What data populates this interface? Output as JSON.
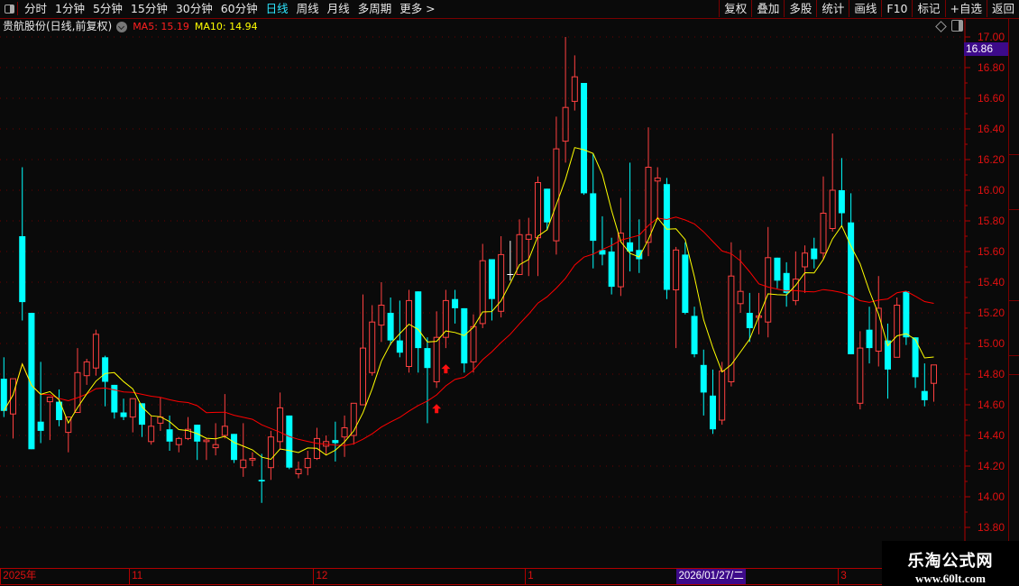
{
  "topbar": {
    "periods": [
      {
        "label": "分时",
        "active": false
      },
      {
        "label": "1分钟",
        "active": false
      },
      {
        "label": "5分钟",
        "active": false
      },
      {
        "label": "15分钟",
        "active": false
      },
      {
        "label": "30分钟",
        "active": false
      },
      {
        "label": "60分钟",
        "active": false
      },
      {
        "label": "日线",
        "active": true
      },
      {
        "label": "周线",
        "active": false
      },
      {
        "label": "月线",
        "active": false
      },
      {
        "label": "多周期",
        "active": false
      },
      {
        "label": "更多 >",
        "active": false
      }
    ],
    "tools": [
      "复权",
      "叠加",
      "多股",
      "统计",
      "画线",
      "F10",
      "标记",
      "+自选",
      "返回"
    ]
  },
  "info": {
    "stock_name": "贵航股份(日线,前复权)",
    "ma5": "MA5: 15.19",
    "ma10": "MA10: 14.94"
  },
  "price_axis": {
    "labels": [
      "17.00",
      "16.80",
      "16.60",
      "16.40",
      "16.20",
      "16.00",
      "15.80",
      "15.60",
      "15.40",
      "15.20",
      "15.00",
      "14.80",
      "14.60",
      "14.40",
      "14.20",
      "14.00",
      "13.80"
    ],
    "current_price": "16.86"
  },
  "date_axis": {
    "labels": [
      {
        "text": "2025年",
        "candle": 0
      },
      {
        "text": "11",
        "candle": 14
      },
      {
        "text": "12",
        "candle": 34
      },
      {
        "text": "1",
        "candle": 57
      },
      {
        "text": "3",
        "candle": 91
      }
    ],
    "cursor_date": "2026/01/27/二",
    "cursor_candle": 77
  },
  "colors": {
    "up": "#ff4040",
    "down": "#00ffff",
    "doji": "#ffffff",
    "ma_fast": "#ffff00",
    "ma_slow": "#ff0000",
    "grid": "#6a0000",
    "signal": "#ff1010"
  },
  "chart_data": {
    "type": "candlestick",
    "ylim": [
      13.8,
      17.0
    ],
    "grid": true,
    "candles_ohlc": [
      [
        14.77,
        14.91,
        14.52,
        14.56
      ],
      [
        14.54,
        14.77,
        14.38,
        14.77
      ],
      [
        15.7,
        16.15,
        15.15,
        15.27
      ],
      [
        15.2,
        15.2,
        14.31,
        14.31
      ],
      [
        14.49,
        14.88,
        14.35,
        14.43
      ],
      [
        14.62,
        14.65,
        14.37,
        14.65
      ],
      [
        14.62,
        14.7,
        14.46,
        14.5
      ],
      [
        14.42,
        14.52,
        14.29,
        14.52
      ],
      [
        14.55,
        14.97,
        14.55,
        14.81
      ],
      [
        14.79,
        14.9,
        14.73,
        14.88
      ],
      [
        14.84,
        15.09,
        14.79,
        15.06
      ],
      [
        14.91,
        14.92,
        14.59,
        14.75
      ],
      [
        14.73,
        14.73,
        14.51,
        14.55
      ],
      [
        14.55,
        14.64,
        14.5,
        14.52
      ],
      [
        14.52,
        14.64,
        14.42,
        14.64
      ],
      [
        14.61,
        14.61,
        14.39,
        14.47
      ],
      [
        14.36,
        14.53,
        14.34,
        14.46
      ],
      [
        14.48,
        14.65,
        14.43,
        14.52
      ],
      [
        14.44,
        14.53,
        14.3,
        14.36
      ],
      [
        14.34,
        14.39,
        14.29,
        14.38
      ],
      [
        14.38,
        14.52,
        14.37,
        14.44
      ],
      [
        14.47,
        14.47,
        14.24,
        14.36
      ],
      [
        14.36,
        14.38,
        14.24,
        14.37
      ],
      [
        14.32,
        14.48,
        14.27,
        14.34
      ],
      [
        14.4,
        14.67,
        14.38,
        14.46
      ],
      [
        14.41,
        14.41,
        14.22,
        14.24
      ],
      [
        14.19,
        14.48,
        14.13,
        14.24
      ],
      [
        14.24,
        14.29,
        14.2,
        14.25
      ],
      [
        14.11,
        14.28,
        13.96,
        14.1
      ],
      [
        14.19,
        14.43,
        14.11,
        14.39
      ],
      [
        14.36,
        14.68,
        14.31,
        14.58
      ],
      [
        14.53,
        14.53,
        14.18,
        14.19
      ],
      [
        14.15,
        14.23,
        14.12,
        14.18
      ],
      [
        14.19,
        14.3,
        14.14,
        14.25
      ],
      [
        14.25,
        14.45,
        14.24,
        14.38
      ],
      [
        14.33,
        14.4,
        14.27,
        14.36
      ],
      [
        14.37,
        14.49,
        14.23,
        14.35
      ],
      [
        14.39,
        14.53,
        14.26,
        14.45
      ],
      [
        14.4,
        14.61,
        14.34,
        14.61
      ],
      [
        14.6,
        15.32,
        14.6,
        14.97
      ],
      [
        14.81,
        15.25,
        14.79,
        15.14
      ],
      [
        15.12,
        15.4,
        15.01,
        15.25
      ],
      [
        15.2,
        15.3,
        14.99,
        15.02
      ],
      [
        15.02,
        15.28,
        14.91,
        14.94
      ],
      [
        14.85,
        15.35,
        14.81,
        15.28
      ],
      [
        15.34,
        15.34,
        14.81,
        14.97
      ],
      [
        14.97,
        15.04,
        14.48,
        14.84
      ],
      [
        14.75,
        15.21,
        14.71,
        15.04
      ],
      [
        15.04,
        15.35,
        14.97,
        15.28
      ],
      [
        15.29,
        15.35,
        15.13,
        15.23
      ],
      [
        15.23,
        15.23,
        14.81,
        14.87
      ],
      [
        14.88,
        15.19,
        14.81,
        15.11
      ],
      [
        15.13,
        15.65,
        15.1,
        15.54
      ],
      [
        15.55,
        15.55,
        15.15,
        15.29
      ],
      [
        15.21,
        15.7,
        15.17,
        15.58
      ],
      [
        15.45,
        15.67,
        15.41,
        15.45
      ],
      [
        15.45,
        15.81,
        15.45,
        15.71
      ],
      [
        15.68,
        15.82,
        15.44,
        15.71
      ],
      [
        15.69,
        16.09,
        15.44,
        16.05
      ],
      [
        16.01,
        16.01,
        15.74,
        15.79
      ],
      [
        15.67,
        16.48,
        15.58,
        16.27
      ],
      [
        16.32,
        17.0,
        16.18,
        16.54
      ],
      [
        16.58,
        16.88,
        16.52,
        16.74
      ],
      [
        16.7,
        16.7,
        15.97,
        15.98
      ],
      [
        15.98,
        16.24,
        15.49,
        15.67
      ],
      [
        15.61,
        15.83,
        15.51,
        15.58
      ],
      [
        15.6,
        15.69,
        15.32,
        15.37
      ],
      [
        15.37,
        15.95,
        15.31,
        15.72
      ],
      [
        15.66,
        16.18,
        15.47,
        15.6
      ],
      [
        15.61,
        15.81,
        15.46,
        15.55
      ],
      [
        15.66,
        16.41,
        15.57,
        16.15
      ],
      [
        16.06,
        16.15,
        15.82,
        16.08
      ],
      [
        16.04,
        16.08,
        15.29,
        15.35
      ],
      [
        15.35,
        15.63,
        14.97,
        15.61
      ],
      [
        15.58,
        15.66,
        15.19,
        15.2
      ],
      [
        15.18,
        15.24,
        14.91,
        14.93
      ],
      [
        14.86,
        14.96,
        14.53,
        14.68
      ],
      [
        14.66,
        14.83,
        14.41,
        14.44
      ],
      [
        14.5,
        14.88,
        14.47,
        14.82
      ],
      [
        14.75,
        15.66,
        14.72,
        15.44
      ],
      [
        15.26,
        15.61,
        15.2,
        15.34
      ],
      [
        15.2,
        15.33,
        15.01,
        15.1
      ],
      [
        15.17,
        15.33,
        15.06,
        15.18
      ],
      [
        15.14,
        15.76,
        15.04,
        15.56
      ],
      [
        15.56,
        15.56,
        15.36,
        15.41
      ],
      [
        15.46,
        15.53,
        15.24,
        15.33
      ],
      [
        15.28,
        15.6,
        15.25,
        15.42
      ],
      [
        15.5,
        15.64,
        15.33,
        15.59
      ],
      [
        15.62,
        15.69,
        15.49,
        15.55
      ],
      [
        15.59,
        16.09,
        15.55,
        15.85
      ],
      [
        15.75,
        16.37,
        15.73,
        16.0
      ],
      [
        16.0,
        16.21,
        15.76,
        15.85
      ],
      [
        15.79,
        15.98,
        14.93,
        14.93
      ],
      [
        14.61,
        15.08,
        14.57,
        14.97
      ],
      [
        15.09,
        15.24,
        14.87,
        14.97
      ],
      [
        14.95,
        15.44,
        14.85,
        15.23
      ],
      [
        15.02,
        15.13,
        14.64,
        14.83
      ],
      [
        14.91,
        15.3,
        14.91,
        15.25
      ],
      [
        15.34,
        15.34,
        14.99,
        15.04
      ],
      [
        15.04,
        15.04,
        14.71,
        14.78
      ],
      [
        14.69,
        14.87,
        14.59,
        14.63
      ],
      [
        14.74,
        14.86,
        14.62,
        14.86
      ]
    ],
    "signals_up_arrow_candles": [
      47,
      48
    ]
  },
  "watermark": {
    "line1": "乐淘公式网",
    "line2": "www.60lt.com"
  }
}
